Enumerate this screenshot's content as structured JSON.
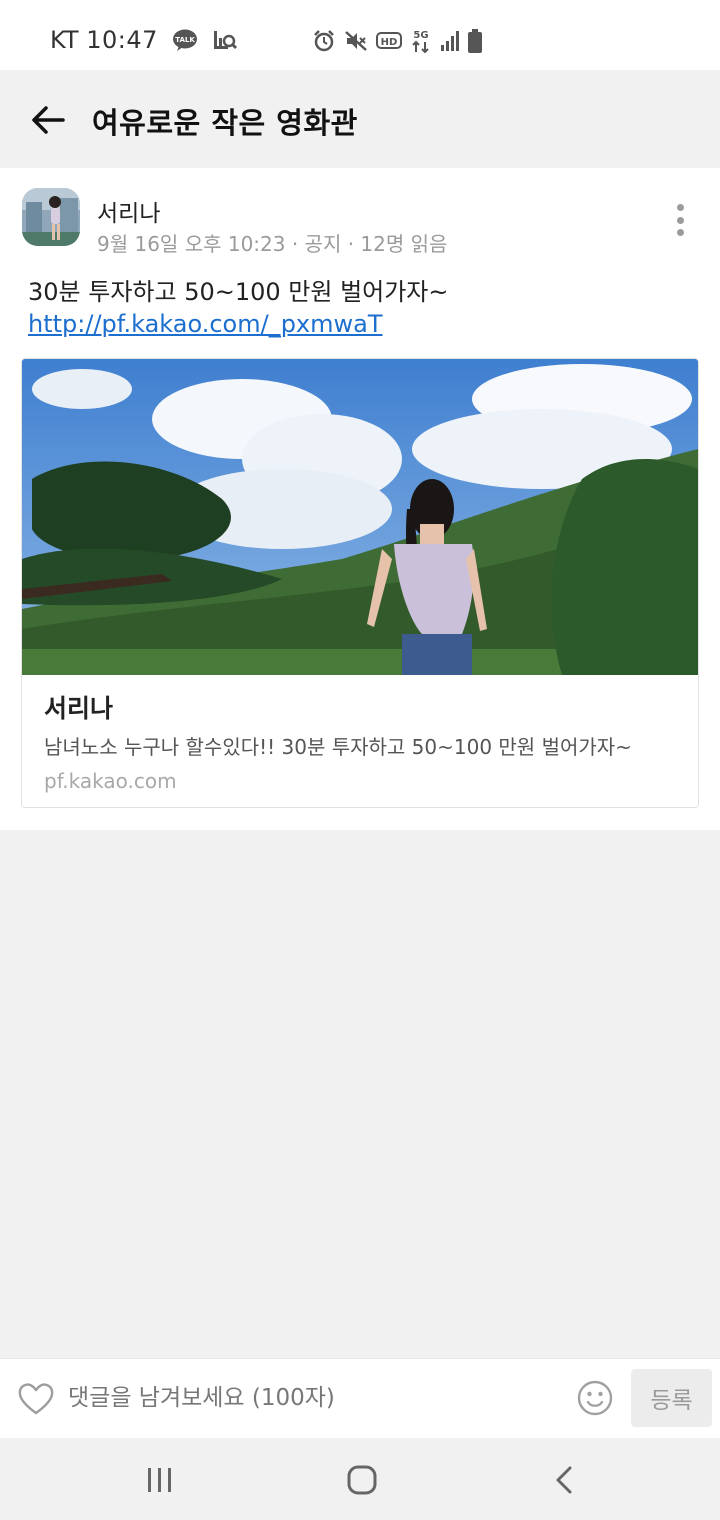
{
  "status_bar": {
    "carrier": "KT",
    "time": "10:47",
    "icons": [
      "kakaotalk-icon",
      "screenshot-search-icon",
      "alarm-icon",
      "mute-icon",
      "hd-voice-icon",
      "5g-icon",
      "signal-icon",
      "battery-icon"
    ],
    "kakaotalk_label": "TALK",
    "hd_label": "HD",
    "network_label": "5G"
  },
  "header": {
    "title": "여유로운 작은 영화관"
  },
  "post": {
    "author": "서리나",
    "meta": "9월 16일 오후 10:23 · 공지 · 12명 읽음",
    "text": "30분 투자하고 50~100 만원 벌어가자~",
    "link": "http://pf.kakao.com/_pxmwaT",
    "preview": {
      "title": "서리나",
      "description": "남녀노소 누구나 할수있다!! 30분 투자하고 50~100 만원 벌어가자~",
      "domain": "pf.kakao.com"
    }
  },
  "comment_bar": {
    "placeholder": "댓글을 남겨보세요 (100자)",
    "submit_label": "등록"
  },
  "colors": {
    "link": "#1c6fcf",
    "background": "#f1f1f2",
    "card": "#ffffff",
    "meta_text": "#9a9a9a"
  }
}
